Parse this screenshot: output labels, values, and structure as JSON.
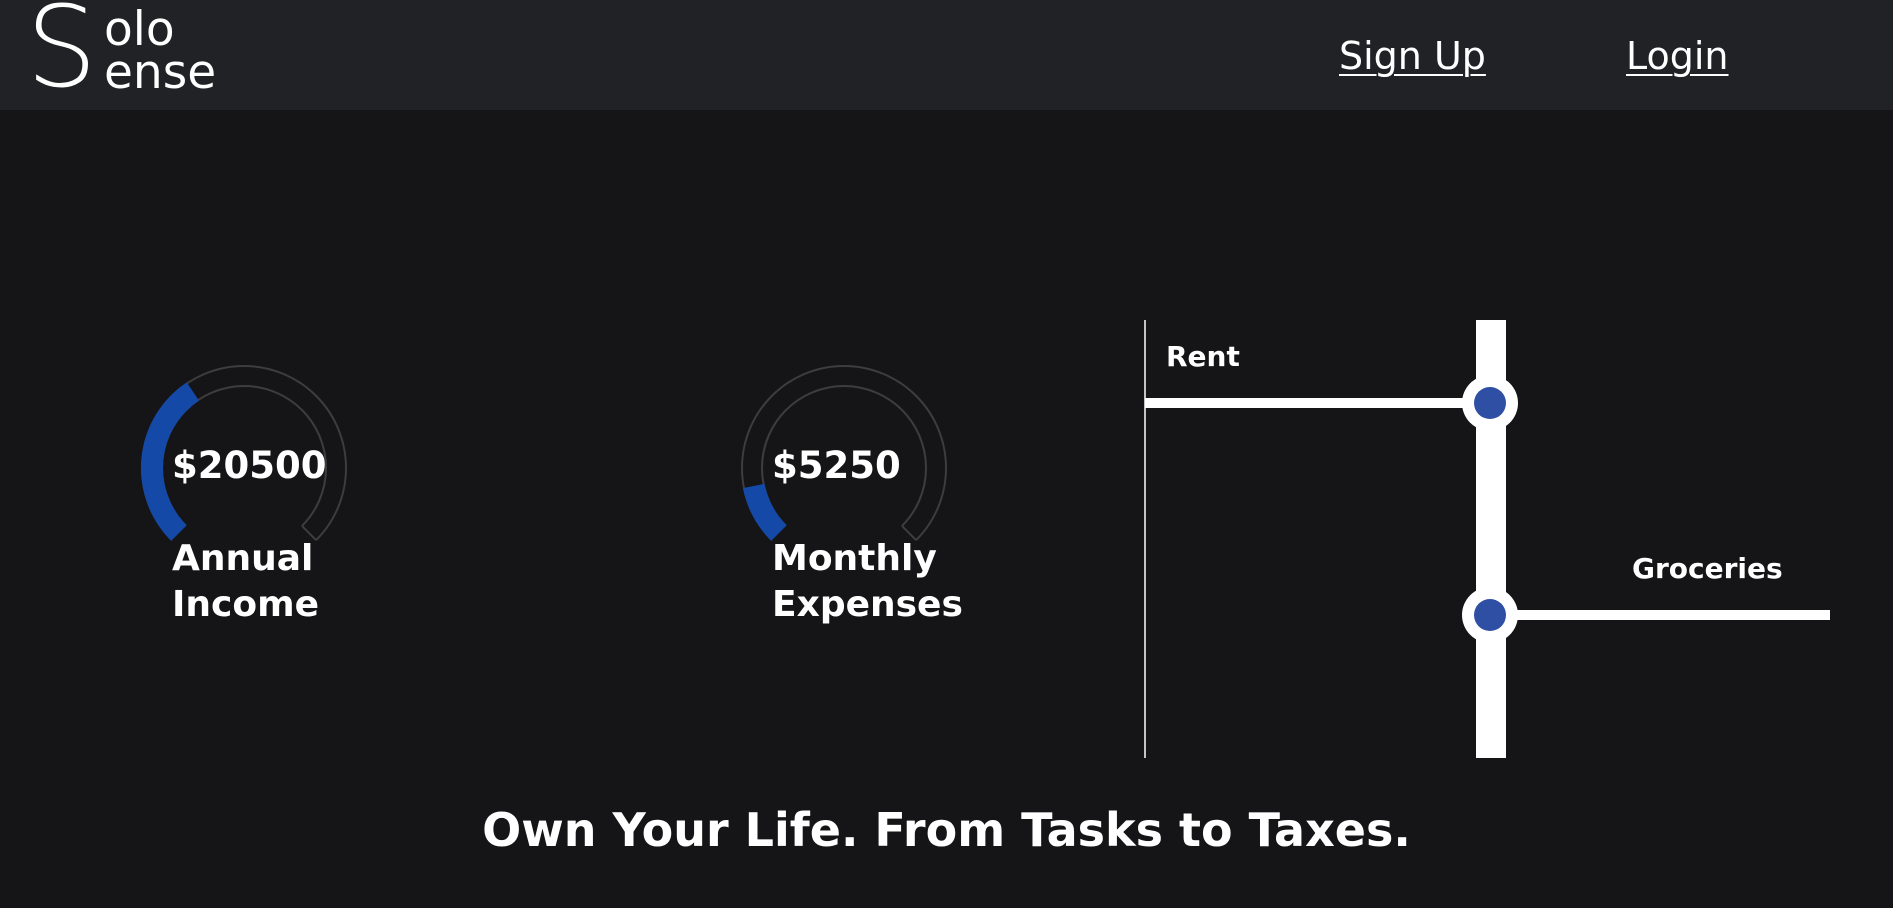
{
  "header": {
    "logo": {
      "initial": "S",
      "line1": "olo",
      "line2": "ense"
    },
    "nav": {
      "signup_label": "Sign Up",
      "login_label": "Login"
    }
  },
  "hero": {
    "gauges": [
      {
        "value": "$20500",
        "label_line1": "Annual",
        "label_line2": "Income",
        "fill_fraction": 0.375
      },
      {
        "value": "$5250",
        "label_line1": "Monthly",
        "label_line2": "Expenses",
        "fill_fraction": 0.125
      }
    ],
    "diagram": {
      "top_label": "Rent",
      "bottom_label": "Groceries"
    },
    "tagline": "Own Your Life. From Tasks to Taxes."
  },
  "colors": {
    "nav_background": "#212226",
    "page_background": "#151517",
    "accent_blue": "#1549a8",
    "node_blue": "#2e4fa3",
    "track_gray": "#3d3d40",
    "text": "#ffffff"
  }
}
